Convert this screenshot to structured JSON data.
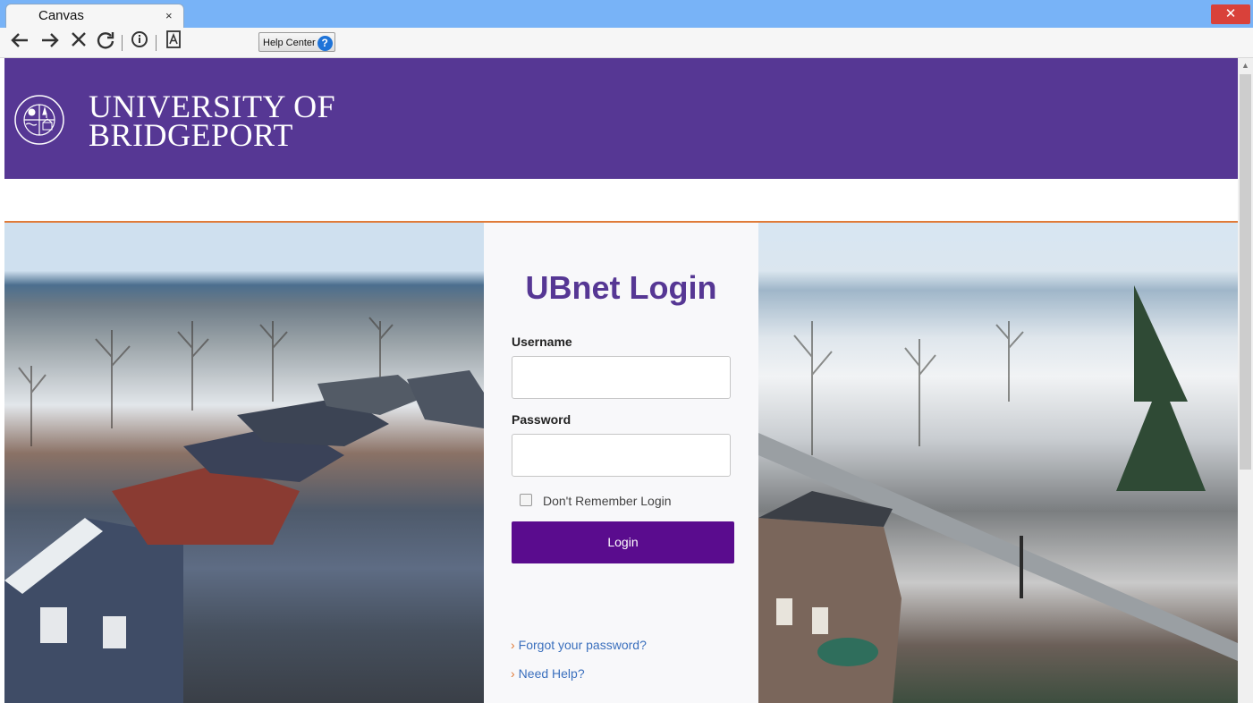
{
  "browser": {
    "tab_title": "Canvas",
    "tab_close_glyph": "×",
    "window_close_glyph": "✕",
    "toolbar": {
      "icons": [
        "back-arrow-icon",
        "forward-arrow-icon",
        "stop-icon",
        "reload-icon",
        "info-icon",
        "reader-icon"
      ],
      "help_center_label": "Help Center",
      "help_icon_glyph": "?"
    }
  },
  "header": {
    "logo_line1": "UNIVERSITY OF",
    "logo_line2": "BRIDGEPORT",
    "seal_ring_text_top": "UNIVERSITY",
    "seal_ring_text_bottom": "BRIDGEPORT",
    "seal_side_left": "OF",
    "seal_year": "1927",
    "brand_color": "#563794",
    "accent_rule_color": "#e07b39"
  },
  "login": {
    "title": "UBnet Login",
    "username_label": "Username",
    "username_value": "",
    "password_label": "Password",
    "password_value": "",
    "remember_label": "Don't Remember Login",
    "remember_checked": false,
    "login_button": "Login",
    "button_color": "#5a0c8e",
    "links": [
      {
        "chevron": "›",
        "label": "Forgot your password?"
      },
      {
        "chevron": "›",
        "label": "Need Help?"
      }
    ],
    "link_color": "#3a6fbd"
  }
}
